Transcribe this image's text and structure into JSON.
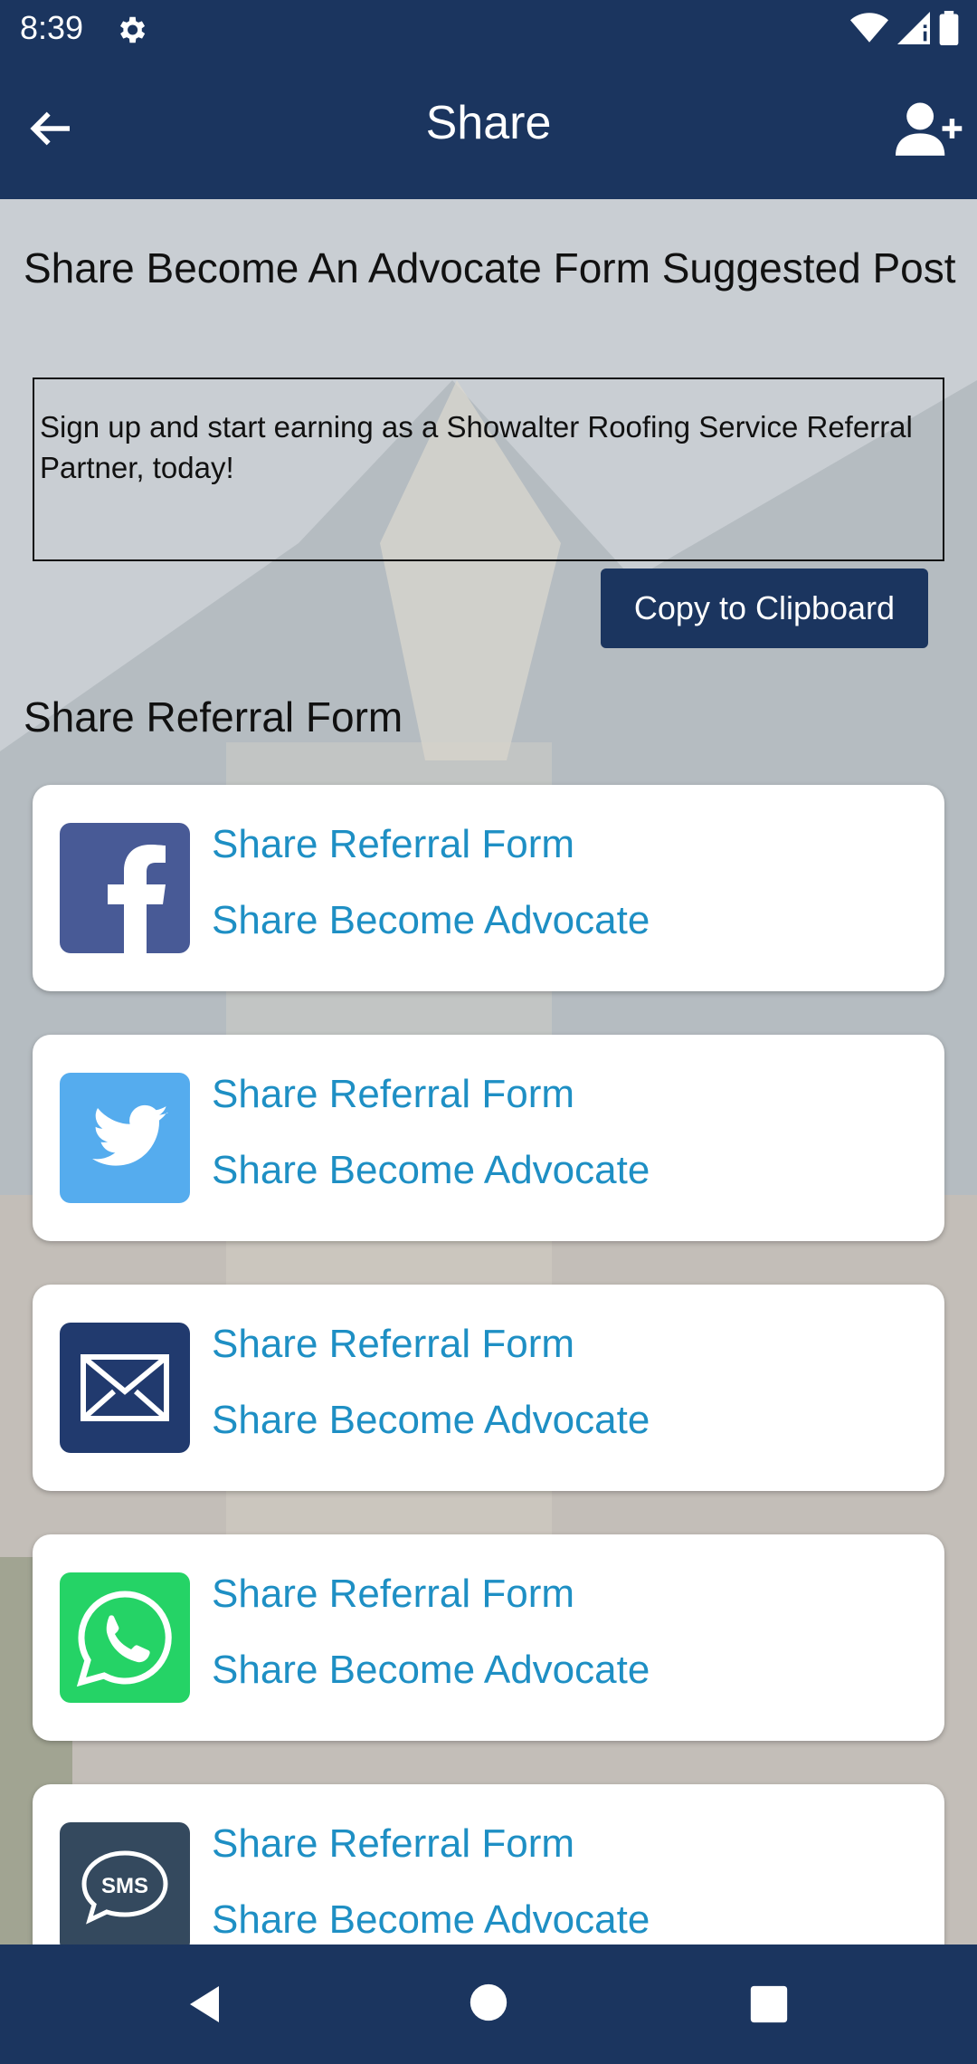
{
  "status": {
    "time": "8:39"
  },
  "appbar": {
    "title": "Share"
  },
  "suggested": {
    "heading": "Share Become An Advocate Form Suggested Post",
    "post_text": "Sign up and start earning as a Showalter Roofing Service Referral Partner, today!",
    "copy_label": "Copy to Clipboard"
  },
  "referral": {
    "heading": "Share Referral Form",
    "cards": [
      {
        "icon": "facebook-icon",
        "color": "#485a96",
        "link1": "Share Referral Form",
        "link2": "Share Become Advocate"
      },
      {
        "icon": "twitter-icon",
        "color": "#55acee",
        "link1": "Share Referral Form",
        "link2": "Share Become Advocate"
      },
      {
        "icon": "email-icon",
        "color": "#213a6e",
        "link1": "Share Referral Form",
        "link2": "Share Become Advocate"
      },
      {
        "icon": "whatsapp-icon",
        "color": "#25d366",
        "link1": "Share Referral Form",
        "link2": "Share Become Advocate"
      },
      {
        "icon": "sms-icon",
        "color": "#34495e",
        "link1": "Share Referral Form",
        "link2": "Share Become Advocate"
      }
    ]
  },
  "colors": {
    "primary": "#1b355f",
    "link": "#1e8fc4"
  }
}
